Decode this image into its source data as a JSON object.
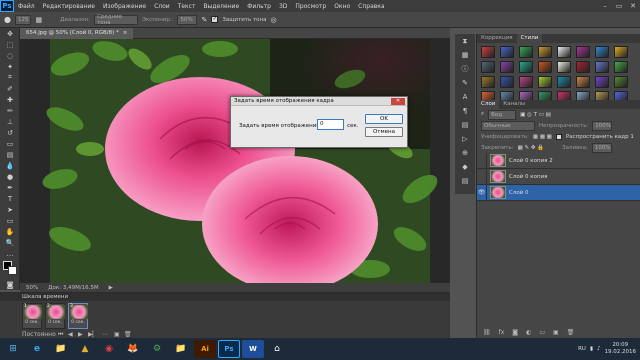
{
  "app": {
    "logo": "Ps"
  },
  "menubar": {
    "items": [
      "Файл",
      "Редактирование",
      "Изображение",
      "Слои",
      "Текст",
      "Выделение",
      "Фильтр",
      "3D",
      "Просмотр",
      "Окно",
      "Справка"
    ]
  },
  "window_controls": [
    "–",
    "▭",
    "✕"
  ],
  "options": {
    "tool_size": "125",
    "range_label": "Диапазон:",
    "range_value": "Средние тона",
    "exposure_label": "Экспонир.:",
    "exposure_value": "50%",
    "protect_label": "Защитить тона"
  },
  "document": {
    "tab_title": "654.jpg @ 50% (Слой 0, RGB/8) *",
    "zoom": "50%",
    "doc_info": "Док: 3,49M/16,5M"
  },
  "timeline": {
    "title": "Шкала времени",
    "frames": [
      {
        "num": "1",
        "duration": "0 сек."
      },
      {
        "num": "2",
        "duration": "0 сек."
      },
      {
        "num": "3",
        "duration": "0 сек."
      }
    ],
    "loop": "Постоянно"
  },
  "dialog": {
    "title": "Задать время отображения кадра",
    "label": "Задать время отображения:",
    "value": "0",
    "unit": "сек.",
    "ok": "OK",
    "cancel": "Отмена"
  },
  "styles_panel": {
    "tabs": [
      "Коррекция",
      "Стили"
    ],
    "active_tab": "Стили",
    "swatches": [
      "#d04040",
      "#4466cc",
      "#33aa55",
      "#cc9933",
      "#eeeeee",
      "#aa3399",
      "#3388cc",
      "#ddaa22",
      "#556677",
      "#8844aa",
      "#22aa88",
      "#cc5522",
      "#eeeedd",
      "#aa2233",
      "#6677cc",
      "#44aa44",
      "#9a7a2a",
      "#3355aa",
      "#bb4488",
      "#aacc33",
      "#2288aa",
      "#cc8844",
      "#7744cc",
      "#558833",
      "#dd6633",
      "#6688aa",
      "#aa66bb",
      "#339966",
      "#cc3366",
      "#88aacc",
      "#bb9955",
      "#5566dd"
    ]
  },
  "layers_panel": {
    "tabs": [
      "Слои",
      "Каналы"
    ],
    "active_tab": "Слои",
    "kind_label": "Вид",
    "blend_mode": "Обычные",
    "opacity_label": "Непрозрачность:",
    "opacity_value": "100%",
    "unify_label": "Унифицировать:",
    "propagate_label": "Распространить кадр 1",
    "lock_label": "Закрепить:",
    "fill_label": "Заливка:",
    "fill_value": "100%",
    "layers": [
      {
        "name": "Слой 0 копия 2",
        "selected": false
      },
      {
        "name": "Слой 0 копия",
        "selected": false
      },
      {
        "name": "Слой 0",
        "selected": true
      }
    ]
  },
  "taskbar": {
    "apps": [
      "⊞",
      "e",
      "📁",
      "▲",
      "◉",
      "🦊",
      "⚙",
      "📁",
      "Ai",
      "Ps",
      "W",
      "⌂"
    ],
    "lang": "RU",
    "time": "20:09",
    "date": "19.02.2016"
  }
}
